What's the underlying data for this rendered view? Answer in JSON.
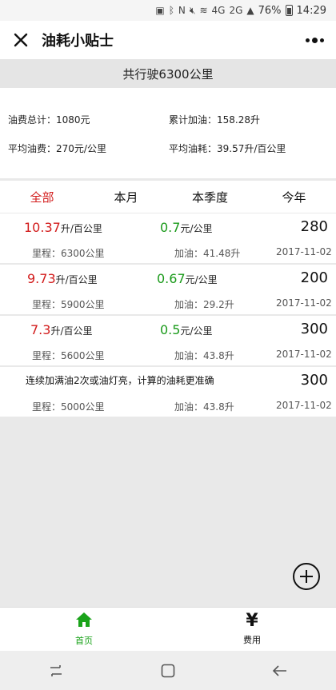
{
  "status_bar": {
    "time": "14:29",
    "battery": "76%",
    "network_label": "4G",
    "signal_label": "2G"
  },
  "header": {
    "title": "油耗小贴士"
  },
  "summary": {
    "total_distance": "共行驶6300公里"
  },
  "stats": {
    "fuel_cost_total": "油费总计：1080元",
    "fuel_total": "累计加油：158.28升",
    "avg_cost": "平均油费：270元/公里",
    "avg_consumption": "平均油耗：39.57升/百公里"
  },
  "tabs": [
    {
      "label": "全部",
      "active": true
    },
    {
      "label": "本月",
      "active": false
    },
    {
      "label": "本季度",
      "active": false
    },
    {
      "label": "今年",
      "active": false
    }
  ],
  "records": [
    {
      "consumption": "10.37",
      "consumption_unit": "升/百公里",
      "cost_per_km": "0.7",
      "cost_unit": "元/公里",
      "amount": "280",
      "mileage": "里程：6300公里",
      "fuel": "加油：41.48升",
      "date": "2017-11-02"
    },
    {
      "consumption": "9.73",
      "consumption_unit": "升/百公里",
      "cost_per_km": "0.67",
      "cost_unit": "元/公里",
      "amount": "200",
      "mileage": "里程：5900公里",
      "fuel": "加油：29.2升",
      "date": "2017-11-02"
    },
    {
      "consumption": "7.3",
      "consumption_unit": "升/百公里",
      "cost_per_km": "0.5",
      "cost_unit": "元/公里",
      "amount": "300",
      "mileage": "里程：5600公里",
      "fuel": "加油：43.8升",
      "date": "2017-11-02"
    },
    {
      "note": "连续加满油2次或油灯亮，计算的油耗更准确",
      "amount": "300",
      "mileage": "里程：5000公里",
      "fuel": "加油：43.8升",
      "date": "2017-11-02"
    }
  ],
  "bottom_nav": [
    {
      "label": "首页",
      "icon": "home-icon",
      "active": true
    },
    {
      "label": "费用",
      "icon": "yen-icon",
      "active": false
    }
  ],
  "colors": {
    "accent_red": "#d21c1c",
    "accent_green": "#1a9a1a",
    "nav_active": "#1aa31a"
  }
}
